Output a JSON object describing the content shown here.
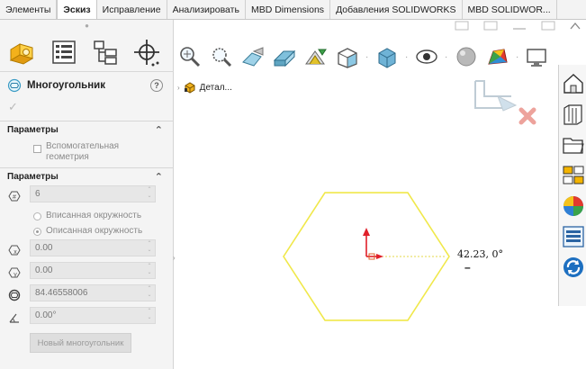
{
  "tabs": [
    "Элементы",
    "Эскиз",
    "Исправление",
    "Анализировать",
    "MBD Dimensions",
    "Добавления SOLIDWORKS",
    "MBD SOLIDWOR..."
  ],
  "active_tab": "Эскиз",
  "property_manager": {
    "title": "Многоугольник",
    "help": "?",
    "section1": {
      "label": "Параметры",
      "construction_label_line1": "Вспомогательная",
      "construction_label_line2": "геометрия"
    },
    "section2": {
      "label": "Параметры",
      "sides_value": "6",
      "inscribed_label": "Вписанная окружность",
      "circumscribed_label": "Описанная окружность",
      "selected_mode": "Описанная окружность",
      "center_x_value": "0.00",
      "center_y_value": "0.00",
      "diameter_value": "84.46558006",
      "angle_value": "0.00°",
      "new_polygon_button": "Новый многоугольник"
    }
  },
  "feature_tree": {
    "item_label": "Детал..."
  },
  "canvas": {
    "dimension_label": "42.23, 0°",
    "dimension_minus": "–",
    "sketch_color": "#f0e84a",
    "origin_color": "#e0202a"
  },
  "icons": {
    "pm_tabs": [
      "feature-manager-icon",
      "property-manager-icon",
      "configuration-manager-icon",
      "dimxpert-icon"
    ],
    "heads_up": [
      "zoom-to-fit-icon",
      "zoom-to-area-icon",
      "previous-view-icon",
      "section-view-icon",
      "dynamic-annotation-icon",
      "view-orientation-icon",
      "display-style-icon",
      "hide-show-icon",
      "edit-appearance-icon",
      "apply-scene-icon",
      "view-settings-icon"
    ],
    "task_pane": [
      "solidworks-resources-icon",
      "design-library-icon",
      "file-explorer-icon",
      "view-palette-icon",
      "appearances-icon",
      "custom-properties-icon",
      "refresh-icon"
    ]
  }
}
